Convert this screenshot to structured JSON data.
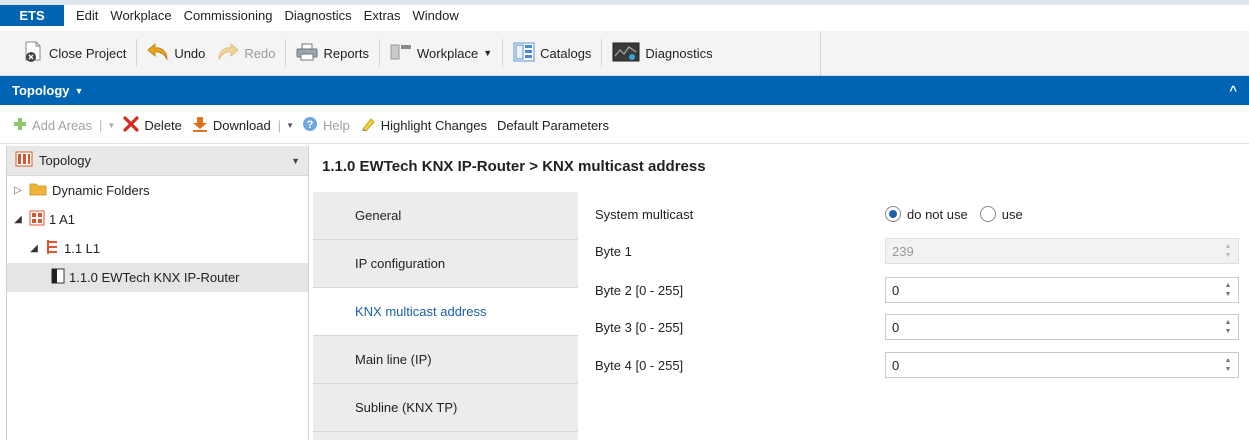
{
  "menubar": {
    "app_label": "ETS",
    "items": [
      "Edit",
      "Workplace",
      "Commissioning",
      "Diagnostics",
      "Extras",
      "Window"
    ]
  },
  "toolbar": {
    "close_project": "Close Project",
    "undo": "Undo",
    "redo": "Redo",
    "reports": "Reports",
    "workplace": "Workplace",
    "catalogs": "Catalogs",
    "diagnostics": "Diagnostics"
  },
  "panel": {
    "title": "Topology",
    "collapse_glyph": "^"
  },
  "actions": {
    "add_areas": "Add Areas",
    "delete": "Delete",
    "download": "Download",
    "help": "Help",
    "highlight_changes": "Highlight Changes",
    "default_parameters": "Default Parameters"
  },
  "tree": {
    "header": "Topology",
    "items": [
      {
        "label": "Dynamic Folders"
      },
      {
        "label": "1 A1"
      },
      {
        "label": "1.1 L1"
      },
      {
        "label": "1.1.0 EWTech KNX IP-Router"
      }
    ]
  },
  "detail": {
    "title": "1.1.0 EWTech KNX IP-Router > KNX multicast address",
    "tabs": [
      "General",
      "IP configuration",
      "KNX multicast address",
      "Main line (IP)",
      "Subline (KNX TP)"
    ],
    "active_tab": "KNX multicast address"
  },
  "params": {
    "system_multicast": {
      "label": "System multicast",
      "option_1": "do not use",
      "option_2": "use",
      "selected": "do not use"
    },
    "byte1": {
      "label": "Byte 1",
      "value": "239"
    },
    "byte2": {
      "label": "Byte 2 [0 - 255]",
      "value": "0"
    },
    "byte3": {
      "label": "Byte 3 [0 - 255]",
      "value": "0"
    },
    "byte4": {
      "label": "Byte 4 [0 - 255]",
      "value": "0"
    }
  },
  "colors": {
    "brand_blue": "#0064b4",
    "active_tab_text": "#1a5fa8",
    "delete_red": "#d62a1e",
    "download_orange": "#e0721c",
    "add_green": "#6fb24a"
  }
}
